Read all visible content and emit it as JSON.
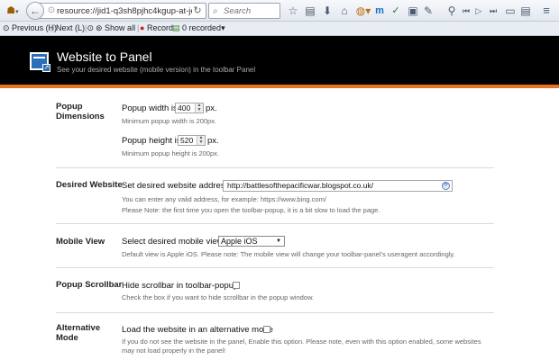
{
  "browser": {
    "url": "resource://jid1-q3sh8pjhc4kgup-at-jetpack/",
    "search_placeholder": "Search"
  },
  "find_bar": {
    "previous": "Previous (H)",
    "next": "Next (L)",
    "show_all": "Show all",
    "record": "Record",
    "recorded": "0 recorded"
  },
  "header": {
    "title": "Website to Panel",
    "subtitle": "See your desired website (mobile version) in the toolbar Panel"
  },
  "sections": {
    "popup_dimensions": {
      "label_line1": "Popup",
      "label_line2": "Dimensions",
      "width_label": "Popup width is",
      "width_value": "400",
      "width_unit": "px.",
      "width_hint": "Minimum popup width is 200px.",
      "height_label": "Popup height is",
      "height_value": "520",
      "height_unit": "px.",
      "height_hint": "Minimum popup height is 200px."
    },
    "desired_website": {
      "label": "Desired Website",
      "field_label": "Set desired website address:",
      "value": "http://battlesofthepacificwar.blogspot.co.uk/",
      "hint1": "You can enter any valid address, for example: https://www.bing.com/",
      "hint2": "Please Note: the first time you open the toolbar-popup, it is a bit slow to load the page."
    },
    "mobile_view": {
      "label": "Mobile View",
      "field_label": "Select desired mobile view:",
      "selected": "Apple iOS",
      "hint": "Default view is Apple iOS. Please note: The mobile view will change your toolbar-panel's useragent accordingly."
    },
    "popup_scrollbar": {
      "label": "Popup Scrollbar",
      "field_label": "Hide scrollbar in toolbar-popup",
      "hint": "Check the box if you want to hide scrollbar in the popup window."
    },
    "alternative_mode": {
      "label_line1": "Alternative",
      "label_line2": "Mode",
      "field_label": "Load the website in an alternative mode",
      "hint1": "If you do not see the website in the panel, Enable this option. Please note, even with this option enabled, some websites",
      "hint2": "may not load properly in the panel!"
    }
  },
  "colors": {
    "header_bg": "#000000",
    "accent": "#e8721e"
  }
}
